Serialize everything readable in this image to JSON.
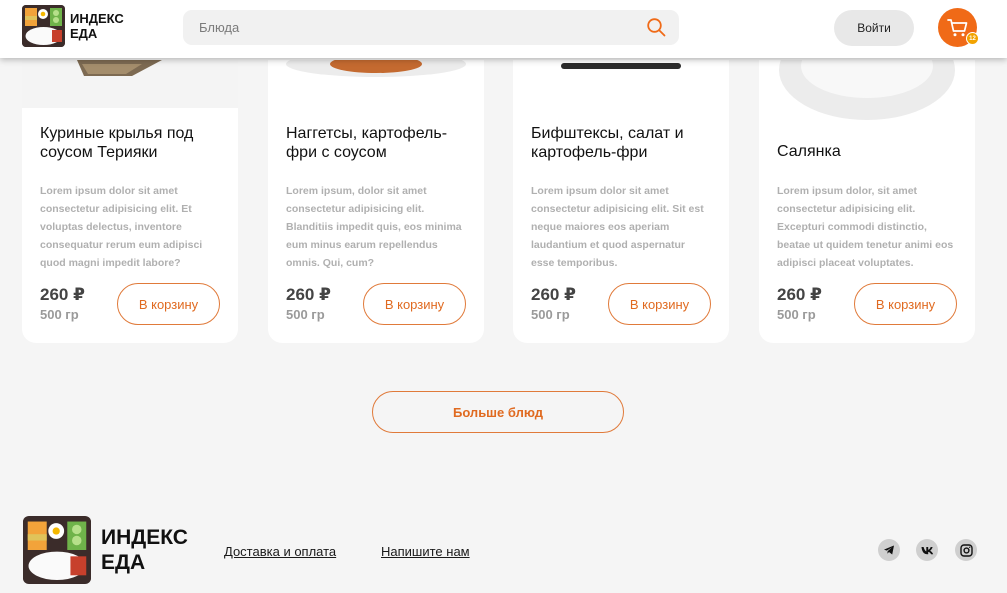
{
  "header": {
    "logo_text": "ИНДЕКС ЕДА",
    "search_placeholder": "Блюда",
    "login_label": "Войти",
    "cart_count": "12",
    "accent": "#f06a17"
  },
  "cards": [
    {
      "title": "Куриные крылья под соусом Терияки",
      "desc": "Lorem ipsum dolor sit amet consectetur adipisicing elit. Et voluptas delectus, inventore consequatur rerum eum adipisci quod magni impedit labore?",
      "price": "260 ₽",
      "weight": "500 гр",
      "button": "В корзину"
    },
    {
      "title": "Наггетсы, картофель-фри с соусом",
      "desc": "Lorem ipsum, dolor sit amet consectetur adipisicing elit. Blanditiis impedit quis, eos minima eum minus earum repellendus omnis. Qui, cum?",
      "price": "260 ₽",
      "weight": "500 гр",
      "button": "В корзину"
    },
    {
      "title": "Бифштексы, салат и картофель-фри",
      "desc": "Lorem ipsum dolor sit amet consectetur adipisicing elit. Sit est neque maiores eos aperiam laudantium et quod aspernatur esse temporibus.",
      "price": "260 ₽",
      "weight": "500 гр",
      "button": "В корзину"
    },
    {
      "title": "Салянка",
      "desc": "Lorem ipsum dolor, sit amet consectetur adipisicing elit. Excepturi commodi distinctio, beatae ut quidem tenetur animi eos adipisci placeat voluptates.",
      "price": "260 ₽",
      "weight": "500 гр",
      "button": "В корзину"
    }
  ],
  "more_button": "Больше блюд",
  "footer": {
    "logo_text": "ИНДЕКС ЕДА",
    "links": [
      "Доставка и оплата",
      "Напишите нам"
    ],
    "socials": [
      "telegram-icon",
      "vk-icon",
      "instagram-icon"
    ]
  }
}
